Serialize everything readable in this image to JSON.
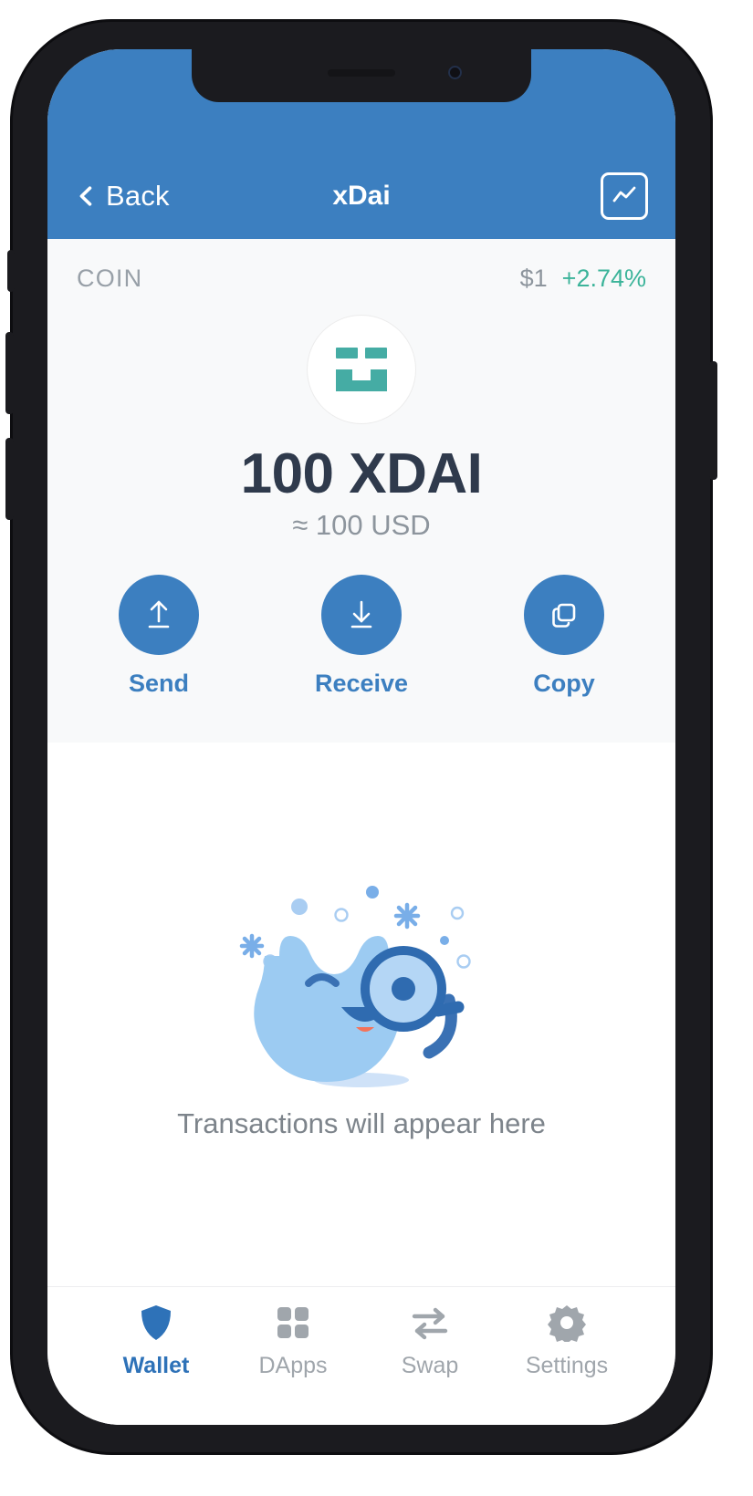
{
  "theme": {
    "brand_blue": "#3c7fc0",
    "active_tab_blue": "#2e72b8",
    "positive_green": "#3cb49a",
    "coin_teal": "#45aca4",
    "muted_grey": "#8d959d",
    "card_bg": "#f8f9fa"
  },
  "navbar": {
    "back_label": "Back",
    "title": "xDai",
    "back_icon": "chevron-left-icon",
    "chart_icon": "line-chart-icon"
  },
  "coin_card": {
    "kind_label": "COIN",
    "price": "$1",
    "change": "+2.74%",
    "logo_icon": "xdai-logo-icon",
    "balance": "100 XDAI",
    "fiat_balance": "≈ 100 USD",
    "actions": [
      {
        "label": "Send",
        "icon": "arrow-up-line-icon"
      },
      {
        "label": "Receive",
        "icon": "arrow-down-line-icon"
      },
      {
        "label": "Copy",
        "icon": "copy-squares-icon"
      }
    ]
  },
  "transactions": {
    "empty_text": "Transactions will appear here",
    "empty_illustration_icon": "winking-blob-magnifier-icon"
  },
  "tabbar": {
    "items": [
      {
        "label": "Wallet",
        "icon": "shield-icon",
        "active": true
      },
      {
        "label": "DApps",
        "icon": "grid-squares-icon",
        "active": false
      },
      {
        "label": "Swap",
        "icon": "swap-arrows-icon",
        "active": false
      },
      {
        "label": "Settings",
        "icon": "gear-icon",
        "active": false
      }
    ]
  }
}
